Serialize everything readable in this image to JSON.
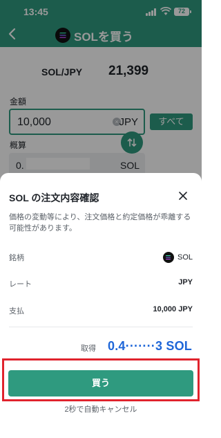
{
  "status_bar": {
    "time": "13:45",
    "battery": "72"
  },
  "header": {
    "title": "SOLを買う"
  },
  "trade": {
    "pair": "SOL/JPY",
    "price": "21,399",
    "amount_label": "金額",
    "amount_value": "10,000",
    "amount_unit": "JPY",
    "all_button": "すべて",
    "approx_label": "概算",
    "approx_value": "0.",
    "approx_unit": "SOL"
  },
  "confirm": {
    "title": "SOL の注文内容確認",
    "notice": "価格の変動等により、注文価格と約定価格が乖離する可能性があります。",
    "rows": [
      {
        "label": "銘柄",
        "value": "SOL"
      },
      {
        "label": "レート",
        "value": "JPY"
      },
      {
        "label": "支払",
        "value": "10,000 JPY"
      }
    ],
    "receive_label": "取得",
    "receive_value": "0.4·······3 SOL",
    "buy_button": "買う",
    "auto_cancel": "2秒で自動キャンセル"
  },
  "colors": {
    "brand_green": "#2f9a7f",
    "receive_blue": "#1e66d8",
    "highlight_red": "#e0232d"
  }
}
